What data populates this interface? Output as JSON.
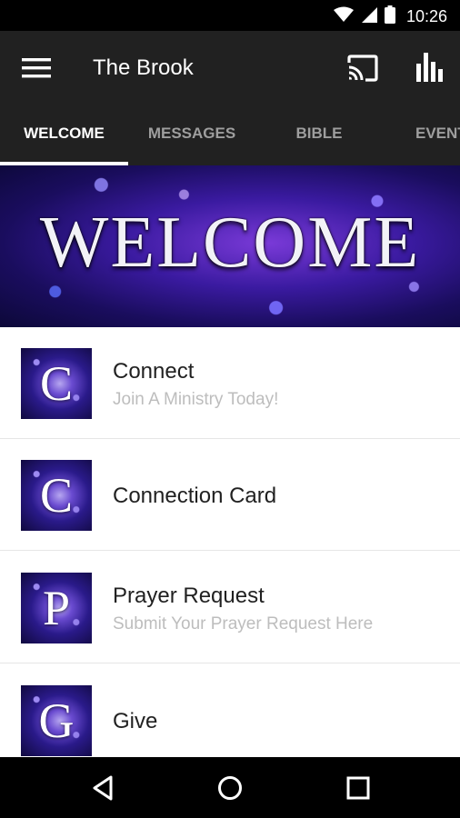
{
  "status_bar": {
    "time": "10:26",
    "icons": [
      "wifi-icon",
      "cell-signal-icon",
      "battery-icon"
    ]
  },
  "app_bar": {
    "title": "The Brook",
    "icons": [
      "menu-icon",
      "cast-icon",
      "bar-chart-icon"
    ]
  },
  "tabs": [
    {
      "label": "WELCOME",
      "active": true
    },
    {
      "label": "MESSAGES",
      "active": false
    },
    {
      "label": "BIBLE",
      "active": false
    },
    {
      "label": "EVENTS",
      "active": false
    }
  ],
  "banner": {
    "text": "WELCOME"
  },
  "list": [
    {
      "letter": "C",
      "title": "Connect",
      "subtitle": "Join A Ministry Today!"
    },
    {
      "letter": "C",
      "title": "Connection Card",
      "subtitle": ""
    },
    {
      "letter": "P",
      "title": "Prayer Request",
      "subtitle": "Submit Your Prayer Request Here"
    },
    {
      "letter": "G",
      "title": "Give",
      "subtitle": ""
    }
  ],
  "nav_bar": {
    "icons": [
      "back-icon",
      "home-icon",
      "recents-icon"
    ]
  },
  "colors": {
    "app_bar": "#212121",
    "active_tab": "#ffffff",
    "inactive_tab": "#9e9e9e",
    "subtitle": "#bdbdbd"
  }
}
